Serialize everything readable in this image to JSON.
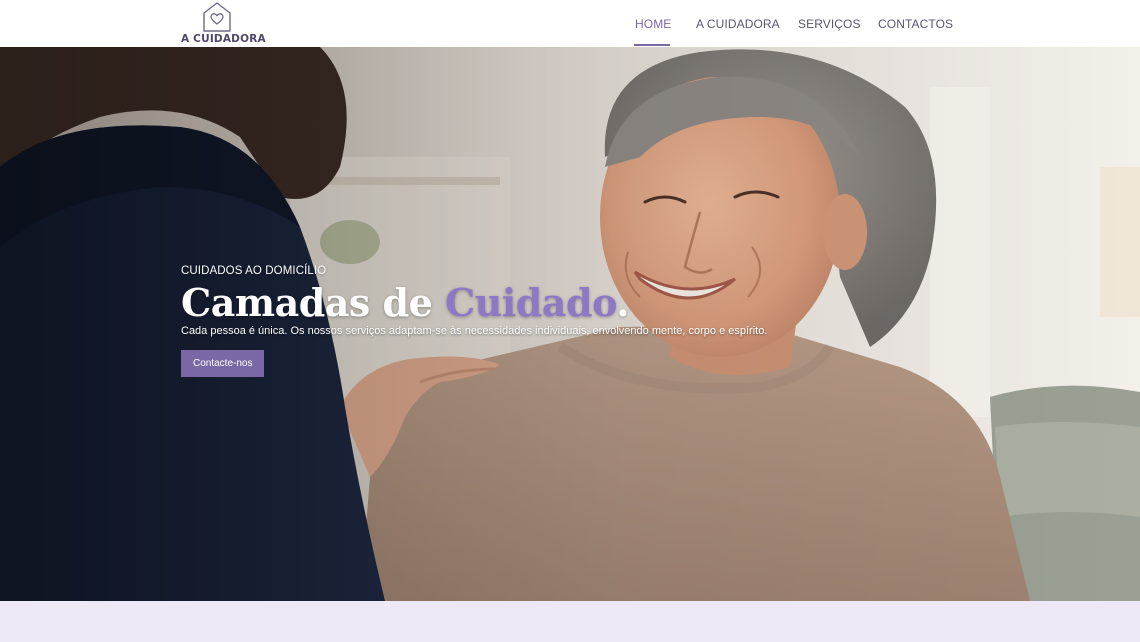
{
  "brand": {
    "name": "A CUIDADORA",
    "color": "#7a68a6"
  },
  "nav": {
    "items": [
      {
        "label": "HOME",
        "active": true
      },
      {
        "label": "A CUIDADORA",
        "active": false
      },
      {
        "label": "SERVIÇOS",
        "active": false
      },
      {
        "label": "CONTACTOS",
        "active": false
      }
    ]
  },
  "hero": {
    "eyebrow": "CUIDADOS AO DOMICÍLIO",
    "headline_part1": "Camadas de ",
    "headline_accent": "Cuidado",
    "headline_end": ".",
    "subtitle": "Cada pessoa é única. Os nossos serviços adaptam-se às necessidades individuais, envolvendo mente, corpo e espírito.",
    "cta_label": "Contacte-nos",
    "accent_color": "#8d78c5"
  },
  "icons": {
    "logo": "house-heart-icon"
  }
}
